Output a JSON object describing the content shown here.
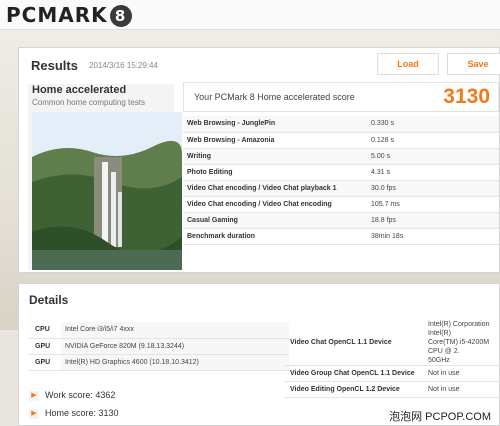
{
  "app": {
    "logo_text": "PCMARK",
    "logo_badge": "8"
  },
  "results": {
    "title": "Results",
    "date": "2014/3/16 15:29:44",
    "load_label": "Load",
    "save_label": "Save",
    "test_name": "Home accelerated",
    "test_subtitle": "Common home computing tests",
    "score_label": "Your PCMark 8 Home accelerated score",
    "score_value": "3130",
    "metrics": [
      {
        "name": "Web Browsing - JunglePin",
        "value": "0.330 s"
      },
      {
        "name": "Web Browsing - Amazonia",
        "value": "0.128 s"
      },
      {
        "name": "Writing",
        "value": "5.00 s"
      },
      {
        "name": "Photo Editing",
        "value": "4.31 s"
      },
      {
        "name": "Video Chat encoding / Video Chat playback 1",
        "value": "30.0 fps"
      },
      {
        "name": "Video Chat encoding / Video Chat encoding",
        "value": "105.7 ms"
      },
      {
        "name": "Casual Gaming",
        "value": "18.8 fps"
      },
      {
        "name": "Benchmark duration",
        "value": "38min 18s"
      }
    ]
  },
  "details": {
    "title": "Details",
    "hardware": [
      {
        "type": "CPU",
        "name": "Intel Core i3/i5/i7 4xxx"
      },
      {
        "type": "GPU",
        "name": "NVIDIA GeForce 820M (9.18.13.3244)"
      },
      {
        "type": "GPU",
        "name": "Intel(R) HD Graphics 4600 (10.18.10.3412)"
      }
    ],
    "opencl": [
      {
        "name": "Video Chat OpenCL 1.1 Device",
        "device": "Intel(R) Corporation Intel(R)\nCore(TM) i5-4200M CPU @ 2.\n50GHz"
      },
      {
        "name": "Video Group Chat OpenCL 1.1 Device",
        "device": "Not in use"
      },
      {
        "name": "Video Editing OpenCL 1.2 Device",
        "device": "Not in use"
      }
    ],
    "work_score": "Work score: 4362",
    "home_score": "Home score: 3130"
  },
  "watermark": "泡泡网 PCPOP.COM",
  "colors": {
    "accent": "#f07a1a"
  }
}
